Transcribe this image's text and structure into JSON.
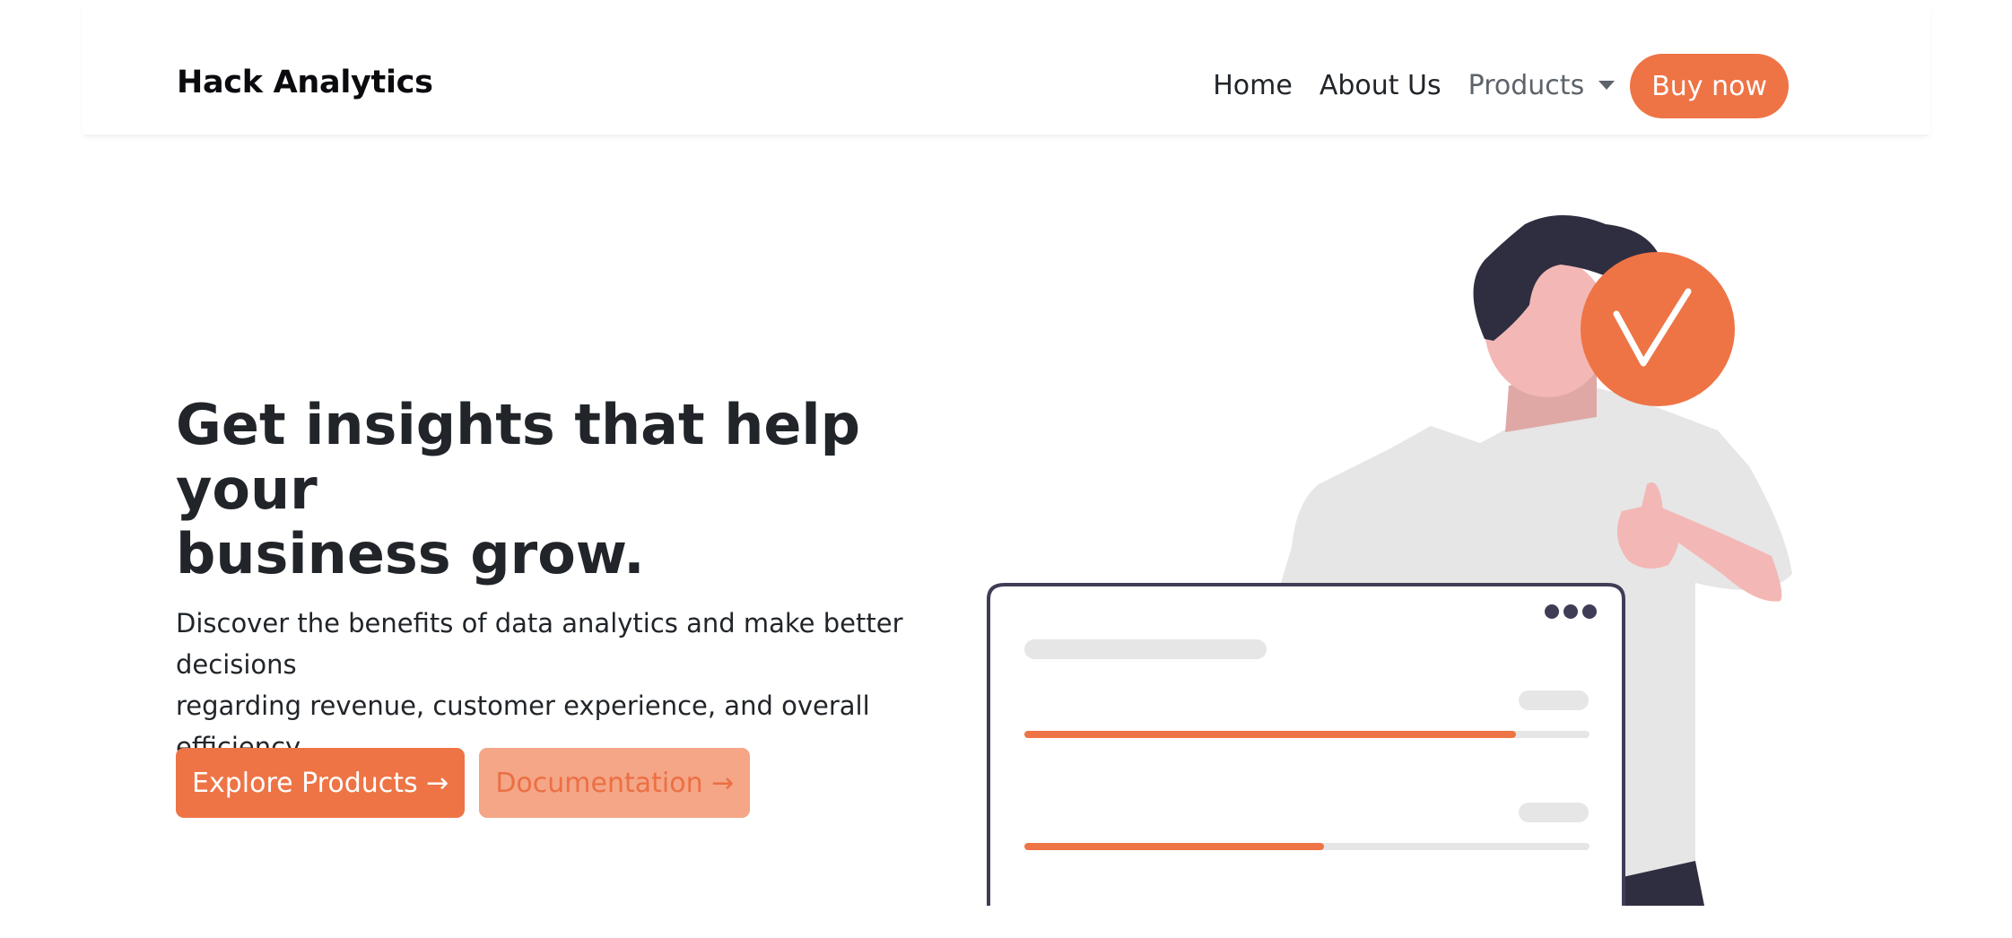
{
  "navbar": {
    "brand": "Hack Analytics",
    "links": [
      {
        "label": "Home"
      },
      {
        "label": "About Us"
      },
      {
        "label": "Products"
      }
    ],
    "buy_label": "Buy now"
  },
  "hero": {
    "title_line1": "Get insights that help your",
    "title_line2": "business grow.",
    "subtitle_line1": "Discover the benefits of data analytics and make better decisions",
    "subtitle_line2": "regarding revenue, customer experience, and overall efficiency.",
    "primary_button": "Explore Products →",
    "secondary_button": "Documentation →"
  },
  "illustration": {
    "progress_1": 0.87,
    "progress_2": 0.53
  },
  "colors": {
    "accent": "#ee7445",
    "accent_light": "#f4a687",
    "dark": "#2f2e41",
    "skin": "#f3b8b5",
    "shirt": "#e6e6e6"
  }
}
